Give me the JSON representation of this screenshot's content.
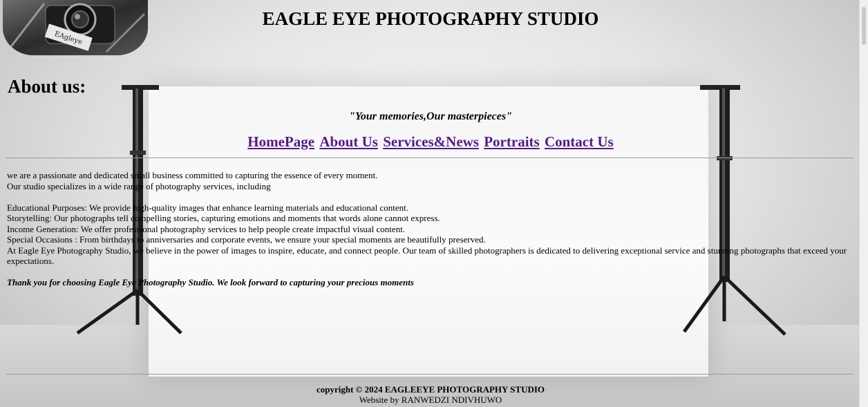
{
  "header": {
    "title": "EAGLE EYE PHOTOGRAPHY STUDIO",
    "logo_text": "EAgleye"
  },
  "about": {
    "heading": "About us:",
    "slogan": "\"Your memories,Our masterpieces\""
  },
  "nav": {
    "items": [
      {
        "label": "HomePage"
      },
      {
        "label": "About Us"
      },
      {
        "label": "Services&News"
      },
      {
        "label": "Portraits"
      },
      {
        "label": "Contact Us"
      }
    ]
  },
  "content": {
    "intro1": "we are a passionate and dedicated small business committed to capturing the essence of every moment.",
    "intro2": "Our studio specializes in a wide range of photography services, including",
    "services": [
      "Educational Purposes: We provide high-quality images that enhance learning materials and educational content.",
      "Storytelling: Our photographs tell compelling stories, capturing emotions and moments that words alone cannot express.",
      "Income Generation: We offer professional photography services to help people create impactful visual content.",
      "Special Occasions : From birthdays to anniversaries and corporate events, we ensure your special moments are beautifully preserved."
    ],
    "closing": "At Eagle Eye Photography Studio, we believe in the power of images to inspire, educate, and connect people. Our team of skilled photographers is dedicated to delivering exceptional service and stunning photographs that exceed your expectations.",
    "thanks": "Thank you for choosing Eagle Eye Photography Studio. We look forward to capturing your precious moments"
  },
  "footer": {
    "copyright": "copyright © 2024 EAGLEEYE PHOTOGRAPHY STUDIO",
    "credit": "Website by RANWEDZI NDIVHUWO"
  }
}
